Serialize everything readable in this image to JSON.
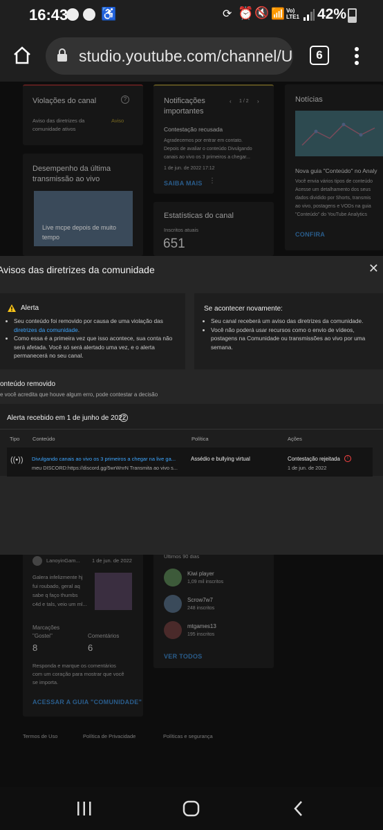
{
  "status": {
    "time": "16:43",
    "network": "Vo) LTE1",
    "battery": "42%"
  },
  "browser": {
    "url": "studio.youtube.com/channel/UC",
    "tabs": "6"
  },
  "background": {
    "violations": {
      "title": "Violações do canal",
      "line1": "Aviso das diretrizes da",
      "line2": "comunidade ativos",
      "badge": "Aviso"
    },
    "notifications": {
      "title1": "Notificações",
      "title2": "importantes",
      "pager": "1 / 2",
      "subtitle": "Contestação recusada",
      "line1": "Agradecemos por entrar em contato.",
      "line2": "Depois de avaliar o conteúdo Divulgando",
      "line3": "canais ao vivo os 3 primeiros a chegar...",
      "date": "1 de jun. de 2022 17:12",
      "link": "SAIBA MAIS"
    },
    "news": {
      "title": "Notícias",
      "headline": "Nova guia \"Conteúdo\" no Analy",
      "line1": "Você envia vários tipos de conteúdo",
      "line2": "Acesse um detalhamento dos seus",
      "line3": "dados dividido por Shorts, transmis",
      "line4": "ao vivo, postagens e VODs na guia",
      "line5": "\"Conteúdo\" do YouTube Analytics",
      "link": "CONFIRA"
    },
    "live": {
      "title1": "Desempenho da última",
      "title2": "transmissão ao vivo",
      "thumb1": "Live mcpe depois de muito",
      "thumb2": "tempo"
    },
    "stats": {
      "title": "Estatísticas do canal",
      "label": "Inscritos atuais",
      "value": "651"
    },
    "community": {
      "author": "LanoyinGam...",
      "date": "1 de jun. de 2022",
      "l1": "Galera infelizmente hj",
      "l2": "fui roubado, geral aq",
      "l3": "sabe q faço thumbs",
      "l4": "c4d e tals, veio um ml...",
      "likes_label1": "Marcações",
      "likes_label2": "\"Gostei\"",
      "likes": "8",
      "comments_label": "Comentários",
      "comments": "6",
      "h1": "Responda e marque os comentários",
      "h2": "com um coração para mostrar que você",
      "h3": "se importa.",
      "link": "ACESSAR A GUIA \"COMUNIDADE\""
    },
    "subs": {
      "period": "Últimos 90 dias",
      "items": [
        {
          "name": "Kiwi player",
          "count": "1,09 mil inscritos"
        },
        {
          "name": "Scrow7w7",
          "count": "248 inscritos"
        },
        {
          "name": "mtgames13",
          "count": "195 inscritos"
        }
      ],
      "link": "VER TODOS"
    },
    "footer": {
      "terms": "Termos de Uso",
      "privacy": "Política de Privacidade",
      "policies": "Políticas e segurança"
    }
  },
  "modal": {
    "title": "Avisos das diretrizes da comunidade",
    "alert_title": "Alerta",
    "alert_b1a": "Seu conteúdo foi removido por causa de uma violação das",
    "alert_b1link": "diretrizes da comunidade",
    "alert_b1end": ".",
    "alert_b2a": "Como essa é a primeira vez que isso acontece, sua conta não",
    "alert_b2b": "será afetada. Você só será alertado uma vez, e o alerta",
    "alert_b2c": "permanecerá no seu canal.",
    "again_title": "Se acontecer novamente:",
    "again_b1": "Seu canal receberá um aviso das diretrizes da comunidade.",
    "again_b2a": "Você não poderá usar recursos como o envio de vídeos,",
    "again_b2b": "postagens na Comunidade ou transmissões ao vivo por uma",
    "again_b2c": "semana.",
    "removed_title": "onteúdo removido",
    "removed_sub": "e você acredita que houve algum erro, pode contestar a decisão",
    "received": "Alerta recebido em 1 de junho de 2022",
    "table": {
      "headers": [
        "Tipo",
        "Conteúdo",
        "Política",
        "Ações"
      ],
      "row": {
        "title": "Divulgando canais ao vivo os 3 primeiros a chegar na live ga...",
        "desc": "meu DISCORD:https://discord.gg/5wrWnrN  Transmita ao vivo s...",
        "policy": "Assédio e bullying virtual",
        "action": "Contestação rejeitada",
        "date": "1 de jun. de 2022"
      }
    }
  }
}
